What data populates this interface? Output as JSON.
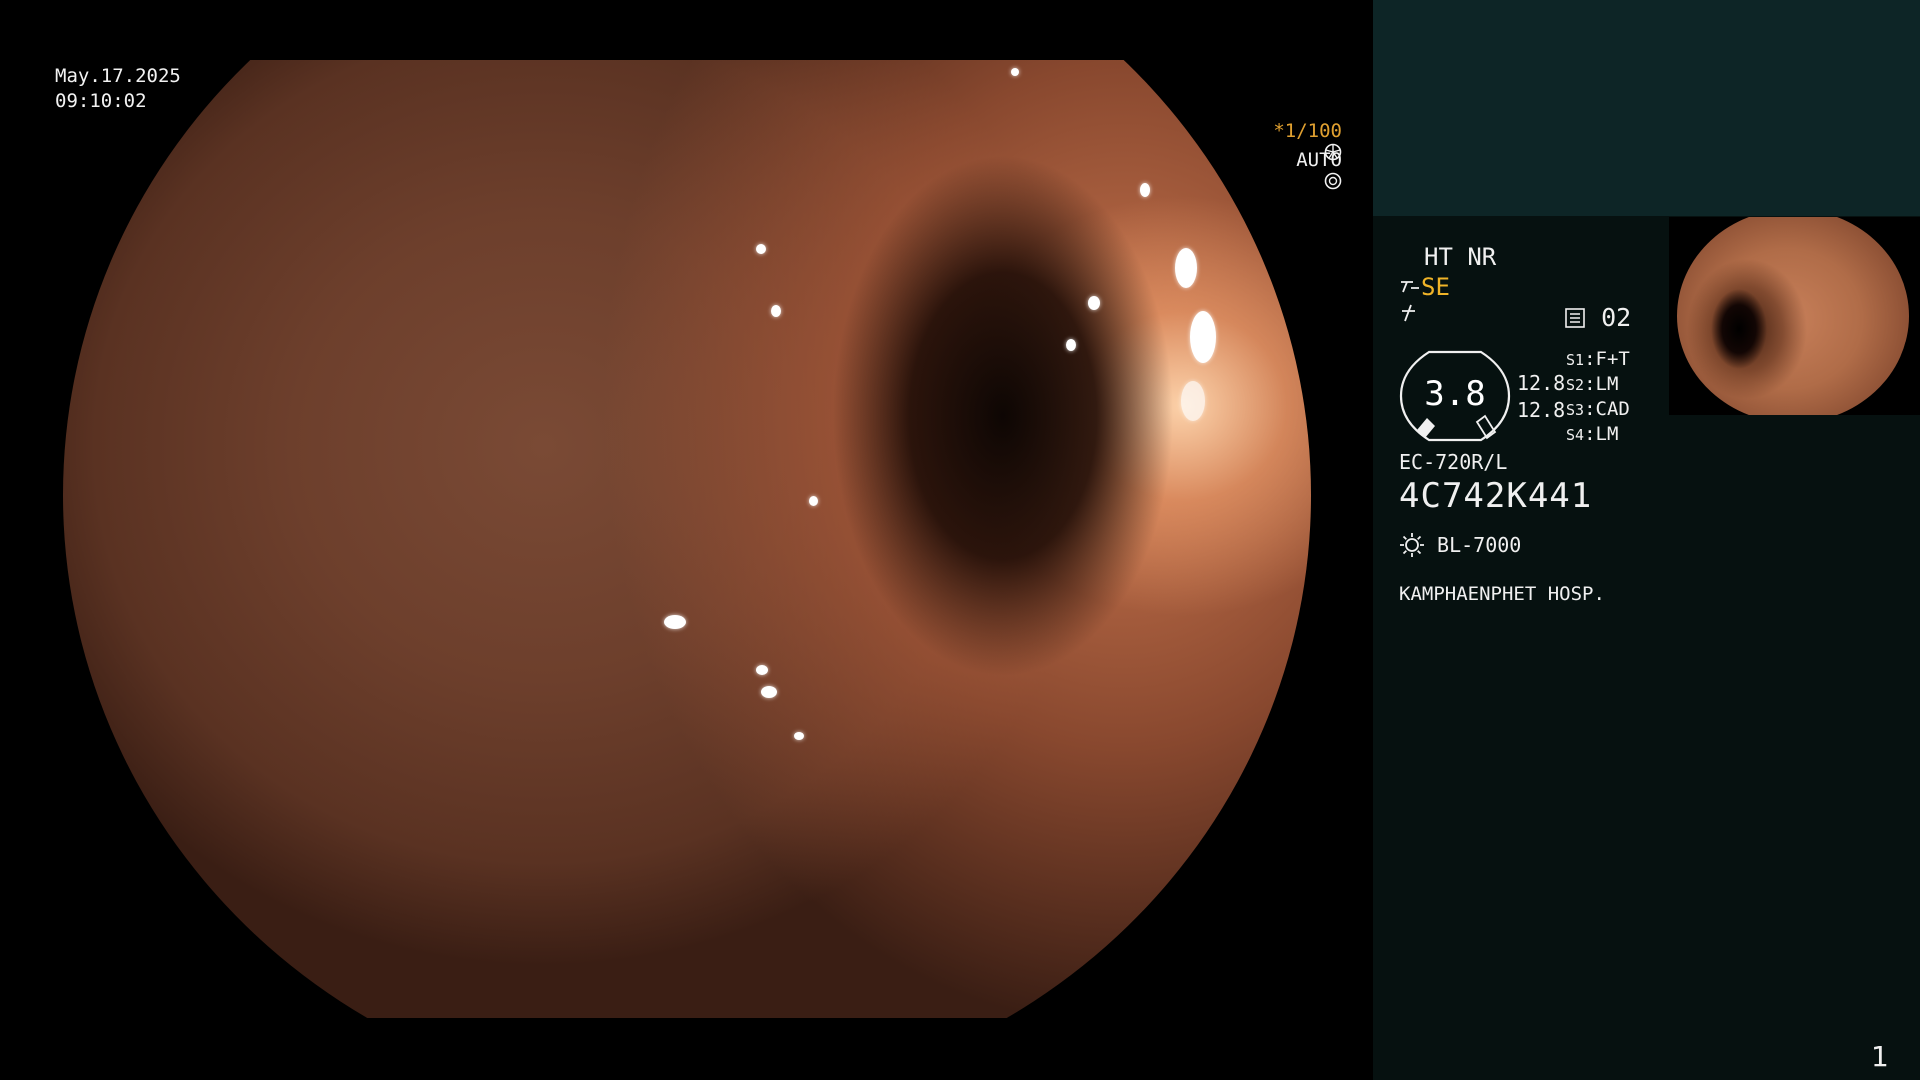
{
  "overlay": {
    "date": "May.17.2025",
    "time": "09:10:02",
    "shutter": "*1/100",
    "exposure_mode": "AUTO"
  },
  "panel": {
    "mode": "HT NR",
    "structure_enhancement": "SE",
    "channel_label": "02",
    "zoom": "3.8",
    "value_a": "12.8",
    "value_b": "12.8",
    "switches": [
      {
        "key": "S1",
        "value": "F+T"
      },
      {
        "key": "S2",
        "value": "LM"
      },
      {
        "key": "S3",
        "value": "CAD"
      },
      {
        "key": "S4",
        "value": "LM"
      }
    ],
    "scope_model": "EC-720R/L",
    "serial": "4C742K441",
    "light_source": "BL-7000",
    "hospital": "KAMPHAENPHET HOSP.",
    "page": "1"
  },
  "colors": {
    "accent_amber": "#e0a030",
    "se_yellow": "#f0b428",
    "panel_bg": "#061110",
    "panel_top_bg": "#0d2526"
  },
  "icons": {
    "shutter": "aperture-icon",
    "auto": "iris-icon",
    "se": "structure-enhance-icon",
    "enh": "color-enhance-icon",
    "channel": "memory-icon",
    "light": "light-source-icon"
  }
}
